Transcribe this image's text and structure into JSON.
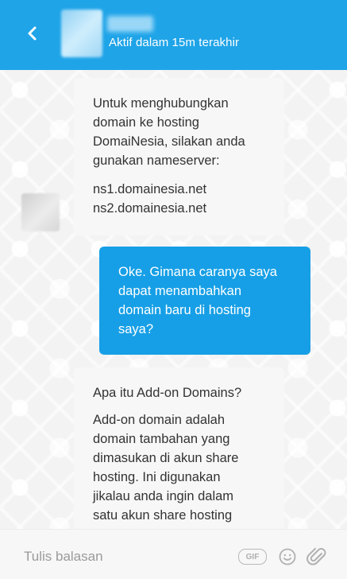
{
  "header": {
    "status": "Aktif dalam 15m terakhir"
  },
  "messages": {
    "m1": {
      "line1": "Untuk menghubungkan",
      "line2": "domain ke hosting",
      "line3": "DomaiNesia, silakan anda",
      "line4": "gunakan nameserver:",
      "ns1": "ns1.domainesia.net",
      "ns2": "ns2.domainesia.net"
    },
    "m2": {
      "line1": "Oke. Gimana caranya saya",
      "line2": "dapat menambahkan",
      "line3": "domain baru di hosting",
      "line4": "saya?"
    },
    "m3": {
      "title": "Apa itu Add-on Domains?",
      "line1": "Add-on domain adalah",
      "line2": "domain tambahan yang",
      "line3": "dimasukan di akun share",
      "line4": "hosting. Ini digunakan",
      "line5": "jikalau anda ingin dalam",
      "line6": "satu akun share hosting"
    }
  },
  "composer": {
    "placeholder": "Tulis balasan",
    "gif_label": "GIF"
  },
  "icons": {
    "back": "chevron-left-icon",
    "emoji": "smiley-icon",
    "attach": "paperclip-icon"
  },
  "colors": {
    "header": "#1fa4e8",
    "outgoing_bubble": "#169fe6",
    "incoming_bubble": "#f7f7f7"
  }
}
